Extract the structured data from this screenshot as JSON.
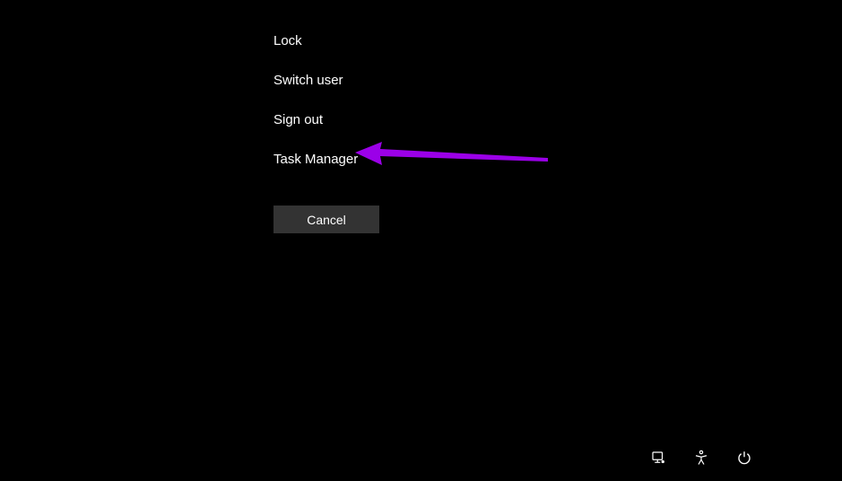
{
  "menu": {
    "items": [
      {
        "label": "Lock"
      },
      {
        "label": "Switch user"
      },
      {
        "label": "Sign out"
      },
      {
        "label": "Task Manager"
      }
    ]
  },
  "cancel": {
    "label": "Cancel"
  },
  "annotation": {
    "color": "#9b00e8"
  },
  "icons": {
    "network": "network-icon",
    "accessibility": "accessibility-icon",
    "power": "power-icon"
  }
}
